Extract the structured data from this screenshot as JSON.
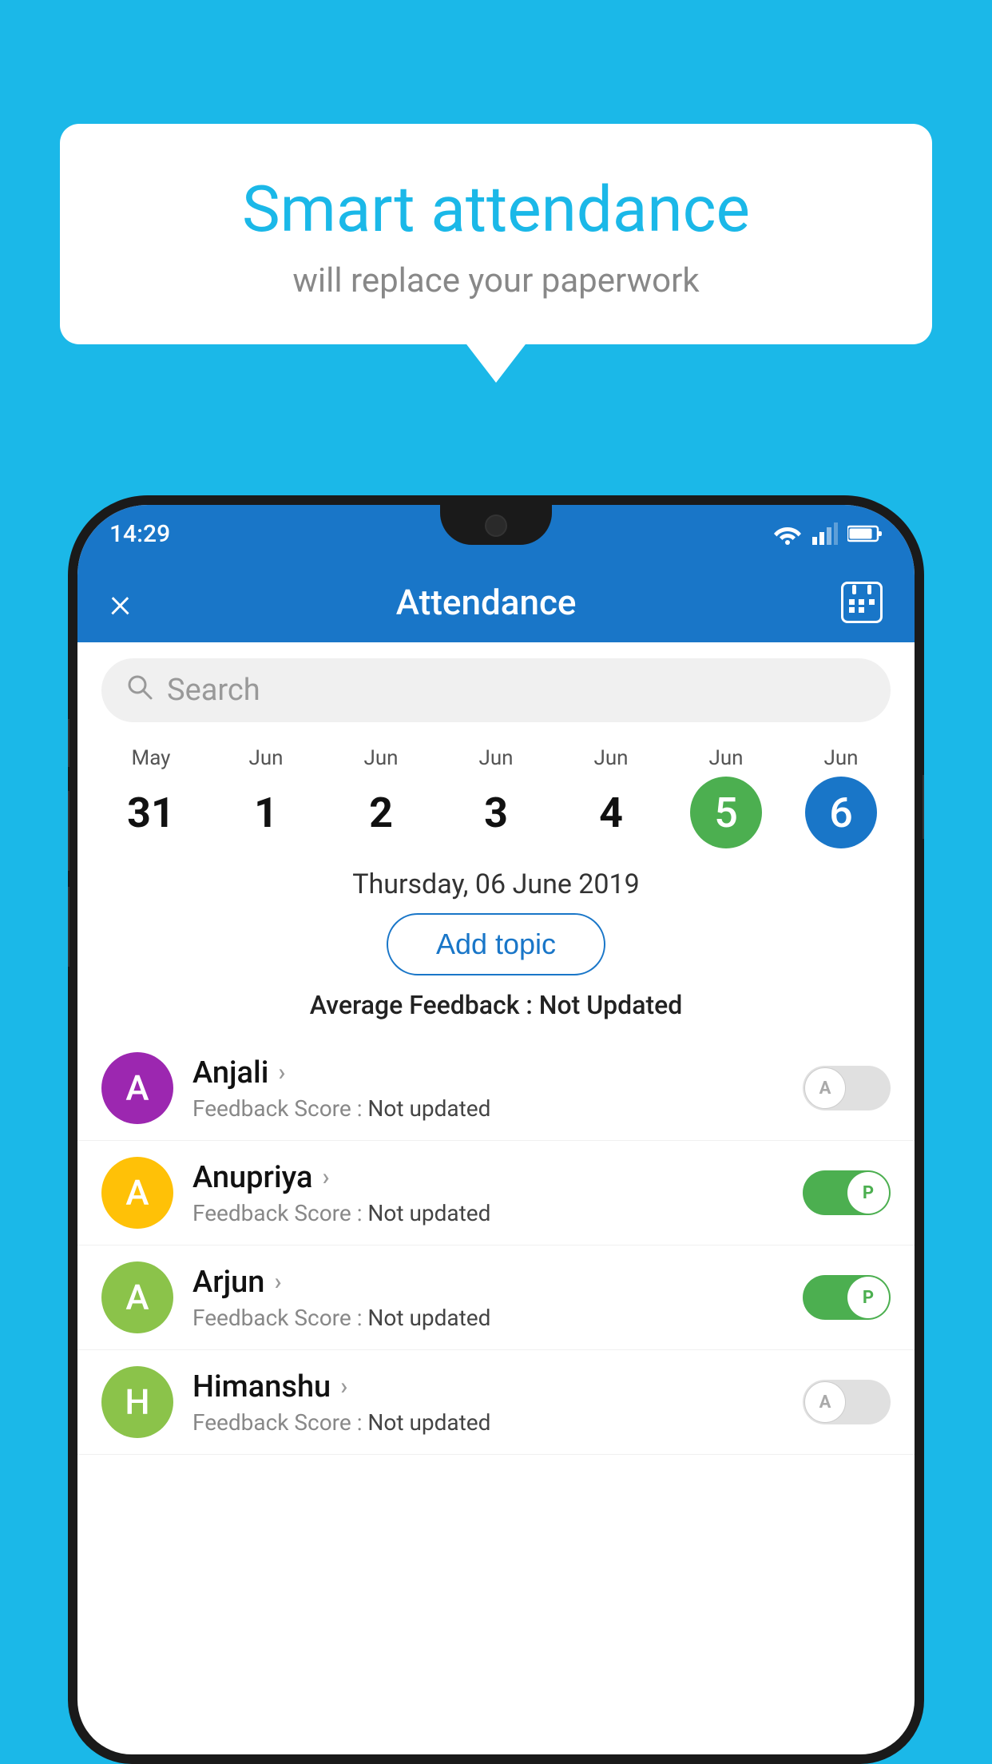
{
  "bubble": {
    "title": "Smart attendance",
    "subtitle": "will replace your paperwork"
  },
  "status_bar": {
    "time": "14:29",
    "wifi_icon": "wifi-icon",
    "signal_icon": "signal-icon",
    "battery_icon": "battery-icon"
  },
  "app_bar": {
    "close_label": "×",
    "title": "Attendance",
    "calendar_icon": "calendar-icon"
  },
  "search": {
    "placeholder": "Search"
  },
  "dates": [
    {
      "month": "May",
      "day": "31",
      "style": "normal"
    },
    {
      "month": "Jun",
      "day": "1",
      "style": "normal"
    },
    {
      "month": "Jun",
      "day": "2",
      "style": "normal"
    },
    {
      "month": "Jun",
      "day": "3",
      "style": "normal"
    },
    {
      "month": "Jun",
      "day": "4",
      "style": "normal"
    },
    {
      "month": "Jun",
      "day": "5",
      "style": "today"
    },
    {
      "month": "Jun",
      "day": "6",
      "style": "selected"
    }
  ],
  "selected_date": "Thursday, 06 June 2019",
  "add_topic_label": "Add topic",
  "avg_feedback_label": "Average Feedback :",
  "avg_feedback_value": "Not Updated",
  "students": [
    {
      "name": "Anjali",
      "avatar_letter": "A",
      "avatar_color": "#9C27B0",
      "feedback_label": "Feedback Score :",
      "feedback_value": "Not updated",
      "toggle": "off"
    },
    {
      "name": "Anupriya",
      "avatar_letter": "A",
      "avatar_color": "#FFC107",
      "feedback_label": "Feedback Score :",
      "feedback_value": "Not updated",
      "toggle": "on"
    },
    {
      "name": "Arjun",
      "avatar_letter": "A",
      "avatar_color": "#8BC34A",
      "feedback_label": "Feedback Score :",
      "feedback_value": "Not updated",
      "toggle": "on"
    },
    {
      "name": "Himanshu",
      "avatar_letter": "H",
      "avatar_color": "#8BC34A",
      "feedback_label": "Feedback Score :",
      "feedback_value": "Not updated",
      "toggle": "off"
    }
  ]
}
